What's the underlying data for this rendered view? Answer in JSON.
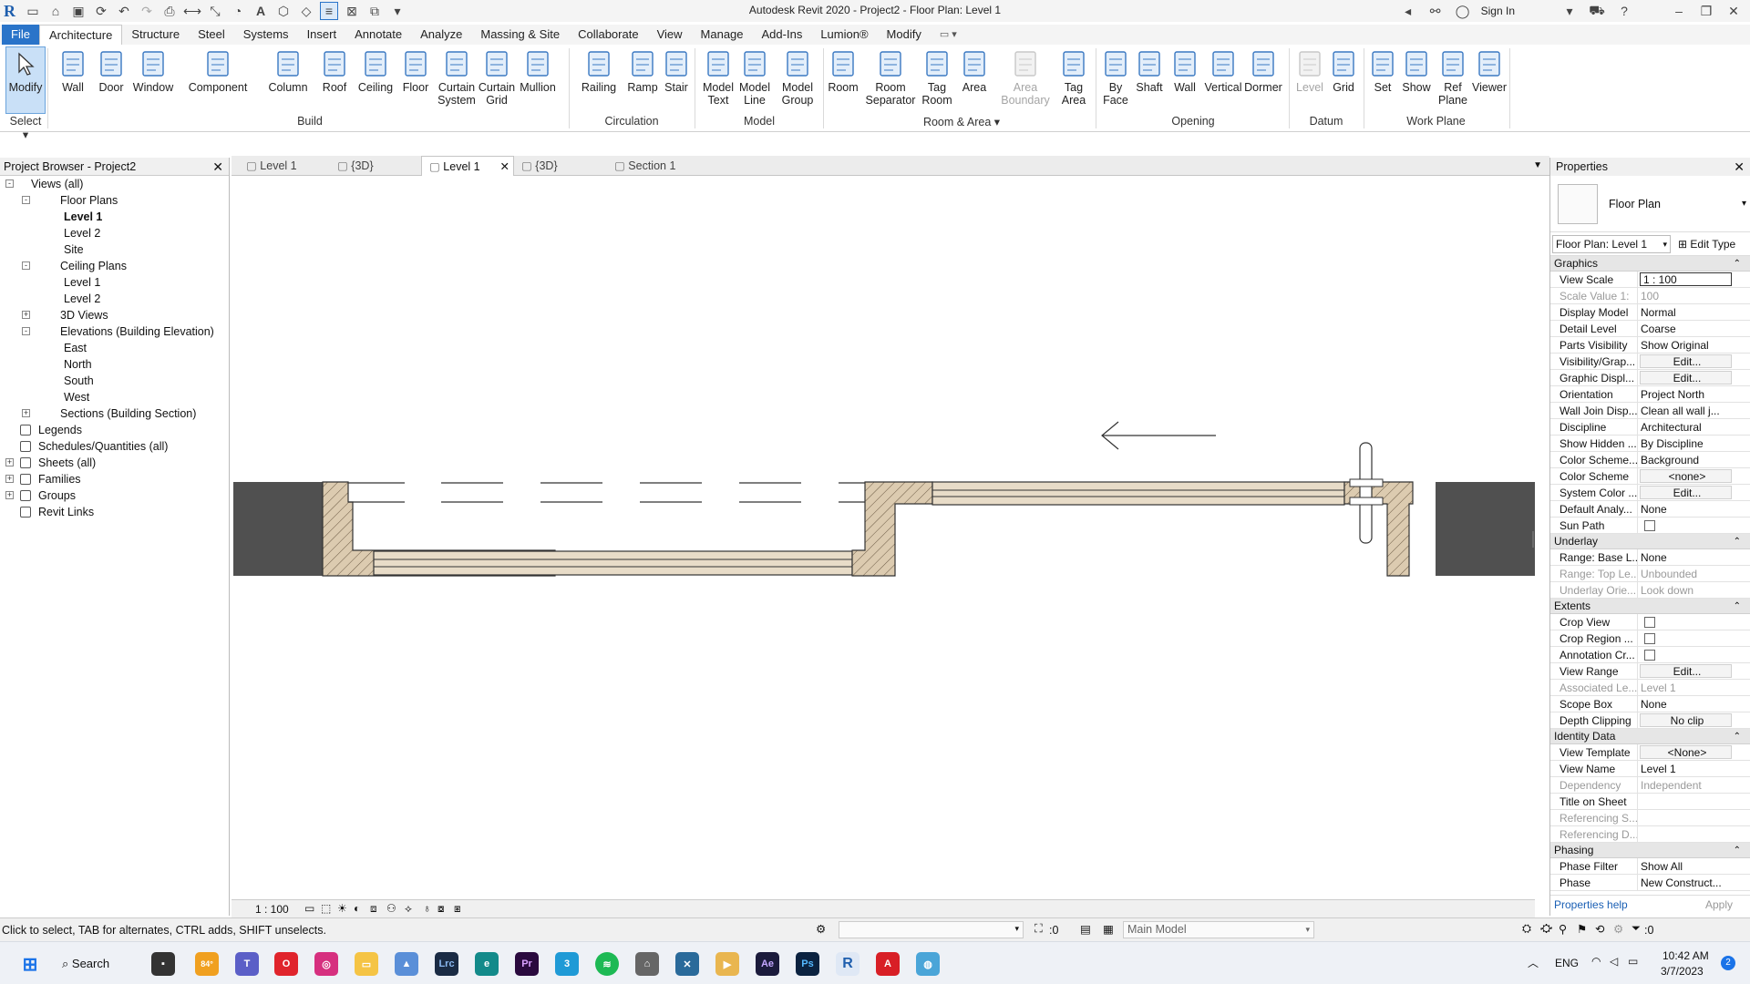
{
  "window": {
    "title": "Autodesk Revit 2020 - Project2 - Floor Plan: Level 1",
    "sign_in": "Sign In"
  },
  "ribbon_tabs": [
    "File",
    "Architecture",
    "Structure",
    "Steel",
    "Systems",
    "Insert",
    "Annotate",
    "Analyze",
    "Massing & Site",
    "Collaborate",
    "View",
    "Manage",
    "Add-Ins",
    "Lumion®",
    "Modify"
  ],
  "ribbon": {
    "modify": "Modify",
    "select": "Select",
    "build": [
      "Wall",
      "Door",
      "Window",
      "Component",
      "Column",
      "Roof",
      "Ceiling",
      "Floor",
      "Curtain System",
      "Curtain Grid",
      "Mullion"
    ],
    "circulation": [
      "Railing",
      "Ramp",
      "Stair"
    ],
    "model": [
      "Model Text",
      "Model Line",
      "Model Group"
    ],
    "room_area": [
      "Room",
      "Room Separator",
      "Tag Room",
      "Area",
      "Area Boundary",
      "Tag Area"
    ],
    "opening": [
      "By Face",
      "Shaft",
      "Wall",
      "Vertical",
      "Dormer"
    ],
    "datum": [
      "Level",
      "Grid"
    ],
    "work_plane": [
      "Set",
      "Show",
      "Ref Plane",
      "Viewer"
    ],
    "panel_labels": {
      "build": "Build",
      "circulation": "Circulation",
      "model": "Model",
      "room_area": "Room & Area",
      "opening": "Opening",
      "datum": "Datum",
      "work_plane": "Work Plane"
    }
  },
  "project_browser": {
    "title": "Project Browser - Project2",
    "items": [
      {
        "label": "Views (all)",
        "indent": 0,
        "tog": "-"
      },
      {
        "label": "Floor Plans",
        "indent": 1,
        "tog": "-"
      },
      {
        "label": "Level 1",
        "indent": 2,
        "bold": true
      },
      {
        "label": "Level 2",
        "indent": 2
      },
      {
        "label": "Site",
        "indent": 2
      },
      {
        "label": "Ceiling Plans",
        "indent": 1,
        "tog": "-"
      },
      {
        "label": "Level 1",
        "indent": 2
      },
      {
        "label": "Level 2",
        "indent": 2
      },
      {
        "label": "3D Views",
        "indent": 1,
        "tog": "+"
      },
      {
        "label": "Elevations (Building Elevation)",
        "indent": 1,
        "tog": "-"
      },
      {
        "label": "East",
        "indent": 2
      },
      {
        "label": "North",
        "indent": 2
      },
      {
        "label": "South",
        "indent": 2
      },
      {
        "label": "West",
        "indent": 2
      },
      {
        "label": "Sections (Building Section)",
        "indent": 1,
        "tog": "+"
      },
      {
        "label": "Legends",
        "indent": 0,
        "icon": true
      },
      {
        "label": "Schedules/Quantities (all)",
        "indent": 0,
        "icon": true
      },
      {
        "label": "Sheets (all)",
        "indent": 0,
        "tog": "+",
        "icon": true
      },
      {
        "label": "Families",
        "indent": 0,
        "tog": "+",
        "icon": true
      },
      {
        "label": "Groups",
        "indent": 0,
        "tog": "+",
        "icon": true
      },
      {
        "label": "Revit Links",
        "indent": 0,
        "icon": true
      }
    ]
  },
  "view_tabs": [
    {
      "label": "Level 1",
      "active": false
    },
    {
      "label": "{3D}",
      "active": false
    },
    {
      "label": "Level 1",
      "active": true
    },
    {
      "label": "{3D}",
      "active": false
    },
    {
      "label": "Section 1",
      "active": false
    }
  ],
  "view_bar": {
    "scale": "1 : 100"
  },
  "properties": {
    "title": "Properties",
    "type_name": "Floor Plan",
    "filter": "Floor Plan: Level 1",
    "edit_type": "Edit Type",
    "groups": [
      {
        "name": "Graphics",
        "rows": [
          {
            "k": "View Scale",
            "v": "1 : 100",
            "style": "box"
          },
          {
            "k": "Scale Value    1:",
            "v": "100",
            "dis": true
          },
          {
            "k": "Display Model",
            "v": "Normal"
          },
          {
            "k": "Detail Level",
            "v": "Coarse"
          },
          {
            "k": "Parts Visibility",
            "v": "Show Original"
          },
          {
            "k": "Visibility/Grap...",
            "v": "Edit...",
            "style": "btn"
          },
          {
            "k": "Graphic Displ...",
            "v": "Edit...",
            "style": "btn"
          },
          {
            "k": "Orientation",
            "v": "Project North"
          },
          {
            "k": "Wall Join Disp...",
            "v": "Clean all wall j..."
          },
          {
            "k": "Discipline",
            "v": "Architectural"
          },
          {
            "k": "Show Hidden ...",
            "v": "By Discipline"
          },
          {
            "k": "Color Scheme...",
            "v": "Background"
          },
          {
            "k": "Color Scheme",
            "v": "<none>",
            "style": "btn"
          },
          {
            "k": "System Color ...",
            "v": "Edit...",
            "style": "btn"
          },
          {
            "k": "Default Analy...",
            "v": "None"
          },
          {
            "k": "Sun Path",
            "v": "",
            "style": "chk"
          }
        ]
      },
      {
        "name": "Underlay",
        "rows": [
          {
            "k": "Range: Base L...",
            "v": "None"
          },
          {
            "k": "Range: Top Le...",
            "v": "Unbounded",
            "dis": true
          },
          {
            "k": "Underlay Orie...",
            "v": "Look down",
            "dis": true
          }
        ]
      },
      {
        "name": "Extents",
        "rows": [
          {
            "k": "Crop View",
            "v": "",
            "style": "chk"
          },
          {
            "k": "Crop Region ...",
            "v": "",
            "style": "chk"
          },
          {
            "k": "Annotation Cr...",
            "v": "",
            "style": "chk"
          },
          {
            "k": "View Range",
            "v": "Edit...",
            "style": "btn"
          },
          {
            "k": "Associated Le...",
            "v": "Level 1",
            "dis": true
          },
          {
            "k": "Scope Box",
            "v": "None"
          },
          {
            "k": "Depth Clipping",
            "v": "No clip",
            "style": "btn"
          }
        ]
      },
      {
        "name": "Identity Data",
        "rows": [
          {
            "k": "View Template",
            "v": "<None>",
            "style": "btn"
          },
          {
            "k": "View Name",
            "v": "Level 1"
          },
          {
            "k": "Dependency",
            "v": "Independent",
            "dis": true
          },
          {
            "k": "Title on Sheet",
            "v": ""
          },
          {
            "k": "Referencing S...",
            "v": "",
            "dis": true
          },
          {
            "k": "Referencing D...",
            "v": "",
            "dis": true
          }
        ]
      },
      {
        "name": "Phasing",
        "rows": [
          {
            "k": "Phase Filter",
            "v": "Show All"
          },
          {
            "k": "Phase",
            "v": "New Construct..."
          }
        ]
      }
    ],
    "help": "Properties help",
    "apply": "Apply"
  },
  "status": {
    "hint": "Click to select, TAB for alternates, CTRL adds, SHIFT unselects.",
    "count": ":0",
    "model": "Main Model",
    "filter_count": ":0"
  },
  "taskbar": {
    "search": "Search",
    "temp": "84°",
    "lang": "ENG",
    "time": "10:42 AM",
    "date": "3/7/2023",
    "badge": "2"
  }
}
